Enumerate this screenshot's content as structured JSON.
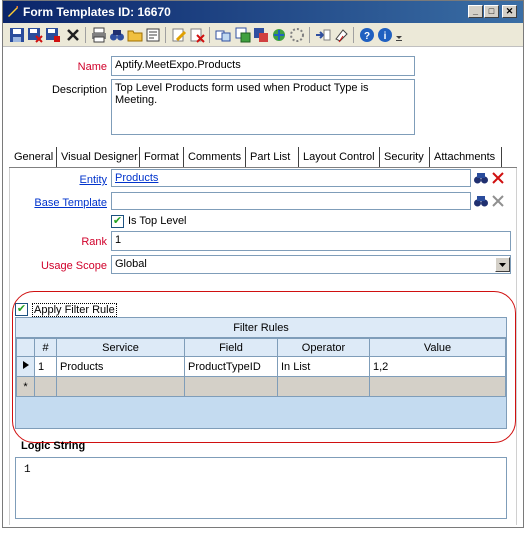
{
  "window": {
    "title": "Form Templates ID: 16670"
  },
  "colors": {
    "title_bar": "#0a246a",
    "required_label": "#d0002a",
    "link_label": "#0033cc",
    "highlight_circle": "#d01010",
    "grid_header": "#ddeaf7"
  },
  "toolbar": {
    "buttons": [
      "save-icon",
      "save-and-close-icon",
      "save-as-icon",
      "delete-icon",
      "print-icon",
      "find-icon",
      "open-folder-icon",
      "properties-icon",
      "edit-icon",
      "refresh-icon",
      "copy-icon",
      "form-icon",
      "web-icon",
      "settings-icon",
      "add-icon",
      "link-icon",
      "help-icon",
      "info-icon",
      "more-icon"
    ]
  },
  "form": {
    "name_label": "Name",
    "name_value": "Aptify.MeetExpo.Products",
    "description_label": "Description",
    "description_value": "Top Level Products form used when Product Type is Meeting."
  },
  "tabs": [
    "General",
    "Visual Designer",
    "Format",
    "Comments",
    "Part List",
    "Layout Control",
    "Security",
    "Attachments"
  ],
  "general": {
    "entity_label": "Entity",
    "entity_value": "Products",
    "base_template_label": "Base Template",
    "base_template_value": "",
    "is_top_level_label": "Is Top Level",
    "is_top_level_checked": true,
    "rank_label": "Rank",
    "rank_value": "1",
    "usage_scope_label": "Usage Scope",
    "usage_scope_value": "Global",
    "apply_filter_label": "Apply Filter Rule",
    "apply_filter_checked": true
  },
  "filter_rules": {
    "caption": "Filter Rules",
    "columns": [
      "#",
      "Service",
      "Field",
      "Operator",
      "Value"
    ],
    "rows": [
      {
        "num": "1",
        "service": "Products",
        "field": "ProductTypeID",
        "operator": "In List",
        "value": "1,2"
      }
    ],
    "new_row_marker": "*"
  },
  "logic": {
    "label": "Logic String",
    "value": "1"
  }
}
